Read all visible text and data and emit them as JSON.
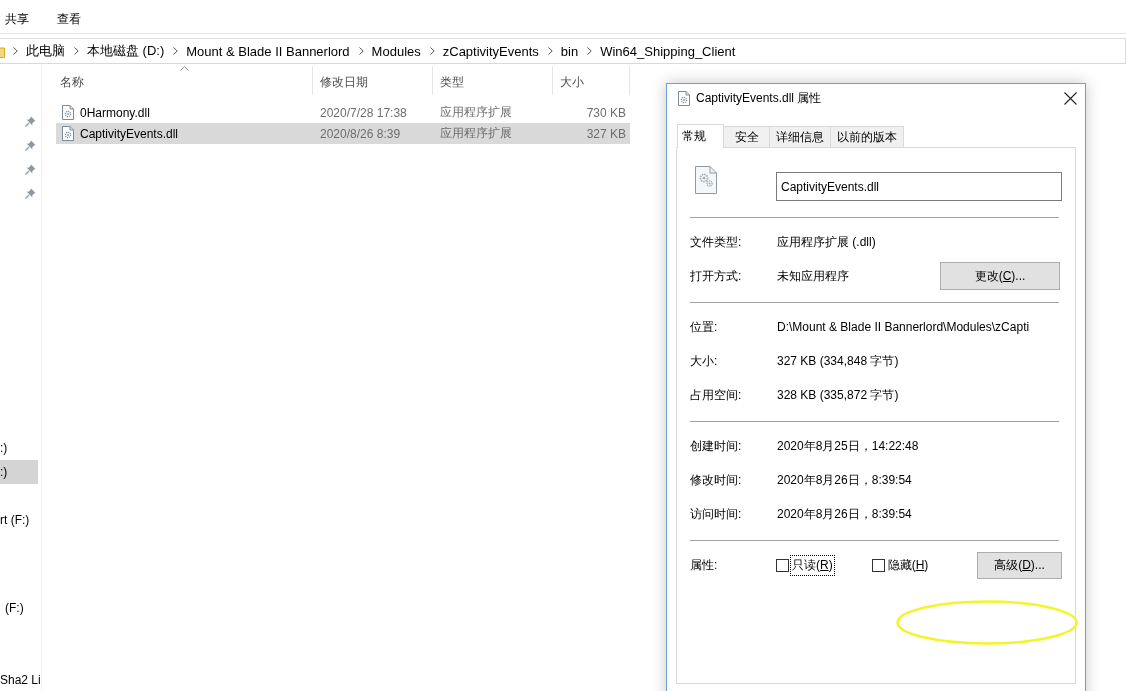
{
  "ribbon": {
    "tabs": [
      {
        "label": "共享"
      },
      {
        "label": "查看"
      }
    ]
  },
  "address_bar": {
    "crumbs": [
      "此电脑",
      "本地磁盘 (D:)",
      "Mount & Blade II Bannerlord",
      "Modules",
      "zCaptivityEvents",
      "bin",
      "Win64_Shipping_Client"
    ]
  },
  "nav_pane": {
    "quick_access": [
      {
        "pinned": true
      },
      {
        "pinned": true
      },
      {
        "pinned": true
      },
      {
        "pinned": true
      }
    ],
    "drives": [
      {
        "label": ":)",
        "selected": false
      },
      {
        "label": ":)",
        "selected": true
      },
      {
        "label": "rt (F:)",
        "selected": false
      },
      {
        "label": "(F:)",
        "selected": false
      },
      {
        "label": "Sha2 Li",
        "selected": false
      }
    ]
  },
  "file_list": {
    "columns": [
      {
        "label": "名称",
        "sorted": true
      },
      {
        "label": "修改日期",
        "sorted": false
      },
      {
        "label": "类型",
        "sorted": false
      },
      {
        "label": "大小",
        "sorted": false
      }
    ],
    "rows": [
      {
        "name": "0Harmony.dll",
        "modified": "2020/7/28 17:38",
        "type": "应用程序扩展",
        "size": "730 KB",
        "selected": false
      },
      {
        "name": "CaptivityEvents.dll",
        "modified": "2020/8/26 8:39",
        "type": "应用程序扩展",
        "size": "327 KB",
        "selected": true
      }
    ]
  },
  "properties_dialog": {
    "title": "CaptivityEvents.dll 属性",
    "tabs": [
      {
        "label": "常规",
        "selected": true
      },
      {
        "label": "安全",
        "selected": false
      },
      {
        "label": "详细信息",
        "selected": false
      },
      {
        "label": "以前的版本",
        "selected": false
      }
    ],
    "file_name": "CaptivityEvents.dll",
    "sections": [
      {
        "rows": [
          {
            "kind": "info",
            "label": "文件类型:",
            "value": "应用程序扩展 (.dll)"
          },
          {
            "kind": "info_button",
            "label": "打开方式:",
            "value": "未知应用程序",
            "button": {
              "label_start": "更改(",
              "access_key": "C",
              "label_end": ")..."
            }
          }
        ]
      },
      {
        "rows": [
          {
            "kind": "info",
            "label": "位置:",
            "value": "D:\\Mount & Blade II Bannerlord\\Modules\\zCapti"
          },
          {
            "kind": "info",
            "label": "大小:",
            "value": "327 KB (334,848 字节)"
          },
          {
            "kind": "info",
            "label": "占用空间:",
            "value": "328 KB (335,872 字节)"
          }
        ]
      },
      {
        "rows": [
          {
            "kind": "info",
            "label": "创建时间:",
            "value": "2020年8月25日，14:22:48"
          },
          {
            "kind": "info",
            "label": "修改时间:",
            "value": "2020年8月26日，8:39:54"
          },
          {
            "kind": "info",
            "label": "访问时间:",
            "value": "2020年8月26日，8:39:54"
          }
        ]
      },
      {
        "rows": [
          {
            "kind": "attributes",
            "label": "属性:",
            "checkboxes": [
              {
                "label_start": "只读(",
                "access_key": "R",
                "label_end": ")",
                "checked": false,
                "focused": true
              },
              {
                "label_start": "隐藏(",
                "access_key": "H",
                "label_end": ")",
                "checked": false,
                "focused": false
              }
            ],
            "button": {
              "label_start": "高级(",
              "access_key": "D",
              "label_end": ")..."
            }
          }
        ]
      }
    ]
  },
  "annotations": [
    {
      "kind": "ellipse"
    }
  ]
}
